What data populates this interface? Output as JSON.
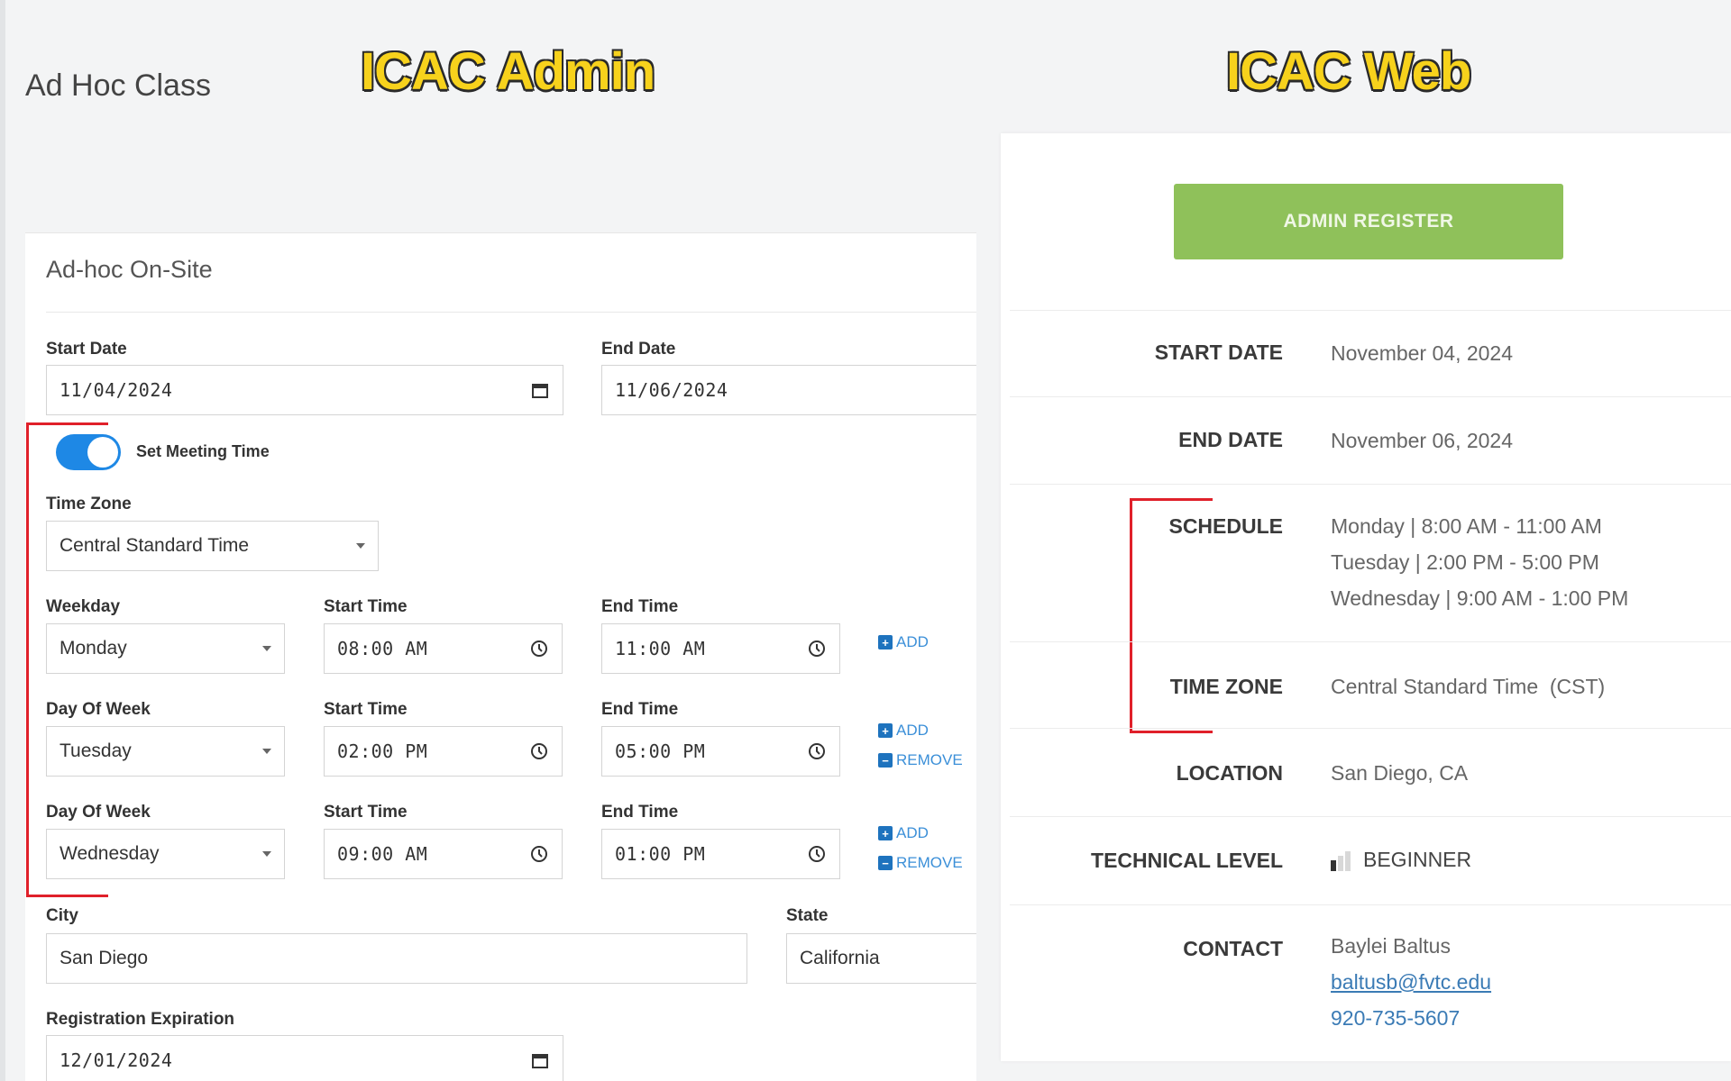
{
  "left_panel": {
    "banner": "ICAC Admin",
    "page_title": "Ad Hoc Class",
    "card_title": "Ad-hoc On-Site",
    "start_date": {
      "label": "Start Date",
      "value": "11/04/2024"
    },
    "end_date": {
      "label": "End Date",
      "value": "11/06/2024"
    },
    "meeting_toggle": {
      "label": "Set Meeting Time",
      "on": true
    },
    "time_zone": {
      "label": "Time Zone",
      "value": "Central Standard Time"
    },
    "schedule_rows": [
      {
        "day_label": "Weekday",
        "day": "Monday",
        "start_label": "Start Time",
        "start": "08:00 AM",
        "end_label": "End Time",
        "end": "11:00 AM",
        "add": "ADD"
      },
      {
        "day_label": "Day Of Week",
        "day": "Tuesday",
        "start_label": "Start Time",
        "start": "02:00 PM",
        "end_label": "End Time",
        "end": "05:00 PM",
        "add": "ADD",
        "remove": "REMOVE"
      },
      {
        "day_label": "Day Of Week",
        "day": "Wednesday",
        "start_label": "Start Time",
        "start": "09:00 AM",
        "end_label": "End Time",
        "end": "01:00 PM",
        "add": "ADD",
        "remove": "REMOVE"
      }
    ],
    "city": {
      "label": "City",
      "value": "San Diego"
    },
    "state": {
      "label": "State",
      "value": "California"
    },
    "registration_expiration": {
      "label": "Registration Expiration",
      "value": "12/01/2024"
    }
  },
  "right_panel": {
    "banner": "ICAC Web",
    "admin_register": "ADMIN REGISTER",
    "start_date": {
      "label": "START DATE",
      "value": "November 04, 2024"
    },
    "end_date": {
      "label": "END DATE",
      "value": "November 06, 2024"
    },
    "schedule": {
      "label": "SCHEDULE",
      "lines": [
        "Monday | 8:00 AM - 11:00 AM",
        "Tuesday | 2:00 PM - 5:00 PM",
        "Wednesday | 9:00 AM - 1:00 PM"
      ]
    },
    "time_zone": {
      "label": "TIME ZONE",
      "value": "Central Standard Time  (CST)"
    },
    "location": {
      "label": "LOCATION",
      "value": "San Diego, CA"
    },
    "technical_level": {
      "label": "TECHNICAL LEVEL",
      "value": "BEGINNER",
      "level": 1,
      "max_level": 3
    },
    "contact": {
      "label": "CONTACT",
      "name": "Baylei Baltus",
      "email": "baltusb@fvtc.edu",
      "phone": "920-735-5607"
    }
  },
  "colors": {
    "accent_blue": "#1e88e5",
    "register_green": "#8fc15a",
    "highlight_red": "#e0202a",
    "banner_yellow": "#f7d21c"
  }
}
